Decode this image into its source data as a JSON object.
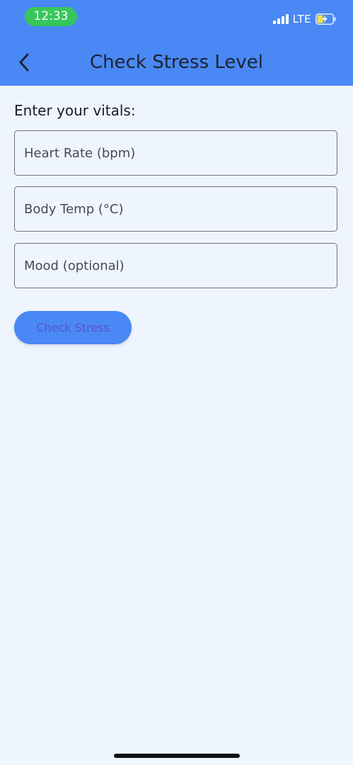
{
  "status_bar": {
    "time": "12:33",
    "network": "LTE"
  },
  "header": {
    "title": "Check Stress Level",
    "back_icon": "chevron-left-icon"
  },
  "form": {
    "section_label": "Enter your vitals:",
    "fields": [
      {
        "placeholder": "Heart Rate (bpm)",
        "value": ""
      },
      {
        "placeholder": "Body Temp (°C)",
        "value": ""
      },
      {
        "placeholder": "Mood (optional)",
        "value": ""
      }
    ],
    "submit_label": "Check Stress"
  },
  "colors": {
    "header_bg": "#4A88F5",
    "page_bg": "#EEF5FF",
    "time_pill": "#36C75A",
    "button_text": "#5A54C8"
  }
}
